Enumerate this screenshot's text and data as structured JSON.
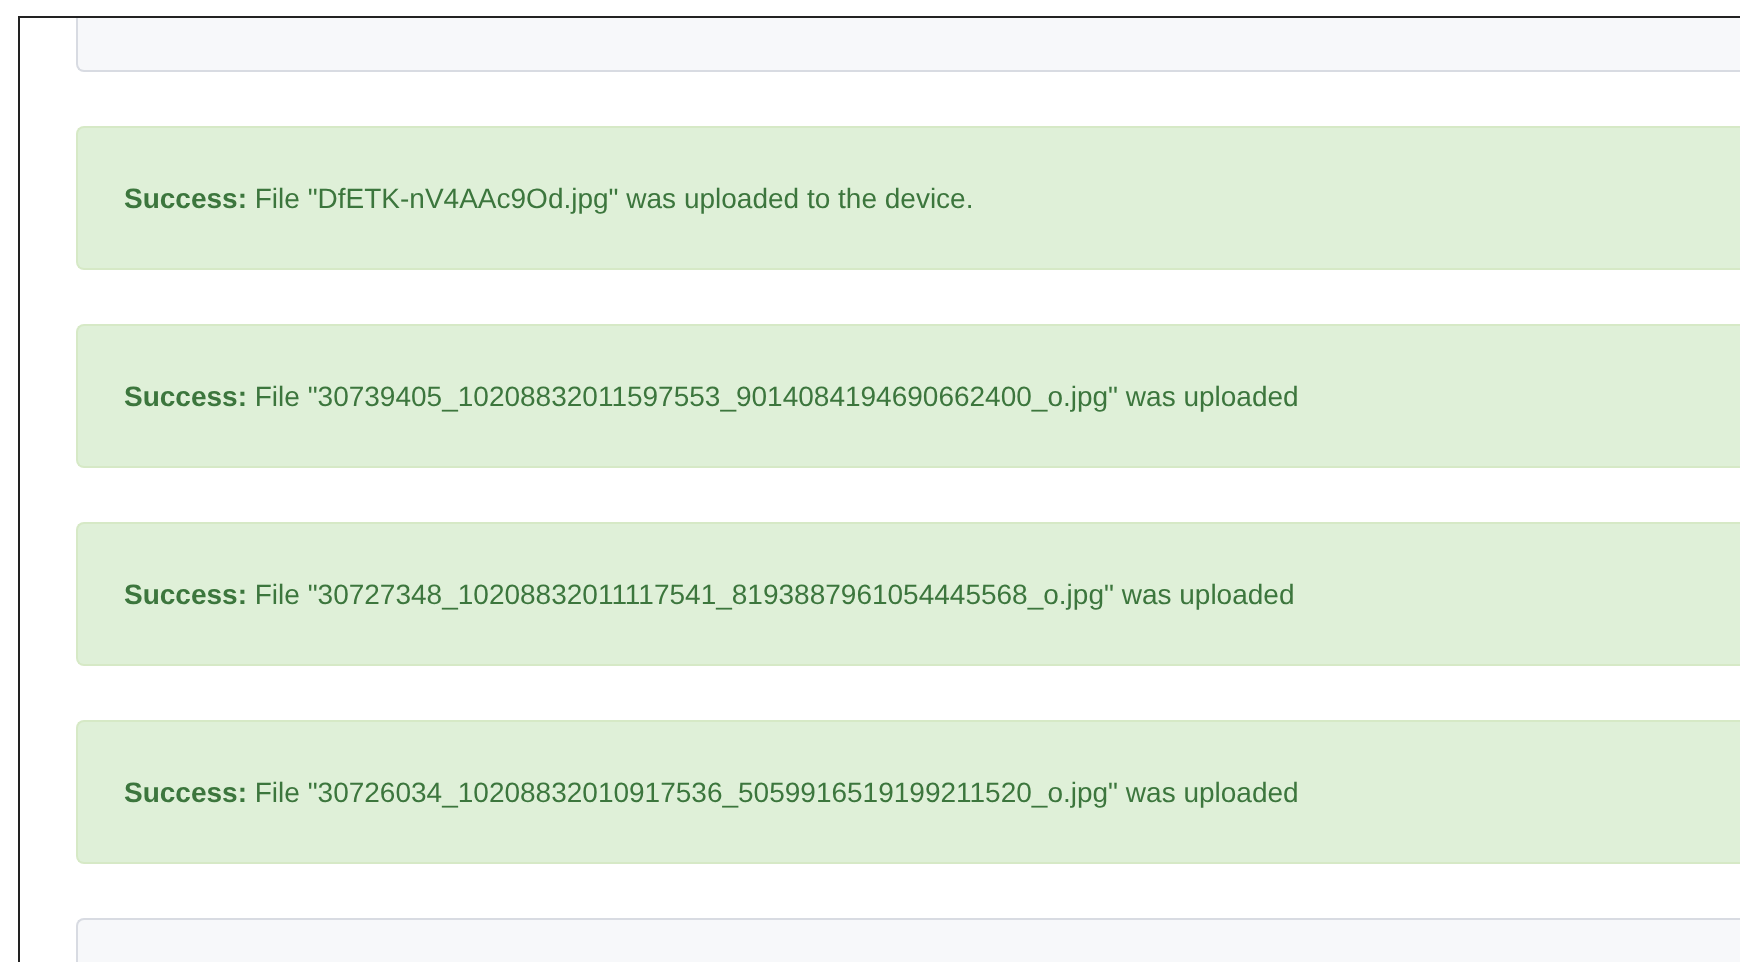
{
  "alerts": [
    {
      "kind": "success",
      "text": "**Success:** File \"DfETK-nV4AAc9Od.jpg\" was uploaded to the device."
    },
    {
      "kind": "success",
      "text": "**Success:** File \"30739405_10208832011597553_9014084194690662400_o.jpg\" was uploaded"
    },
    {
      "kind": "success",
      "text": "**Success:** File \"30727348_10208832011117541_8193887961054445568_o.jpg\" was uploaded"
    },
    {
      "kind": "success",
      "text": "**Success:** File \"30726034_10208832010917536_5059916519199211520_o.jpg\" was uploaded"
    }
  ]
}
